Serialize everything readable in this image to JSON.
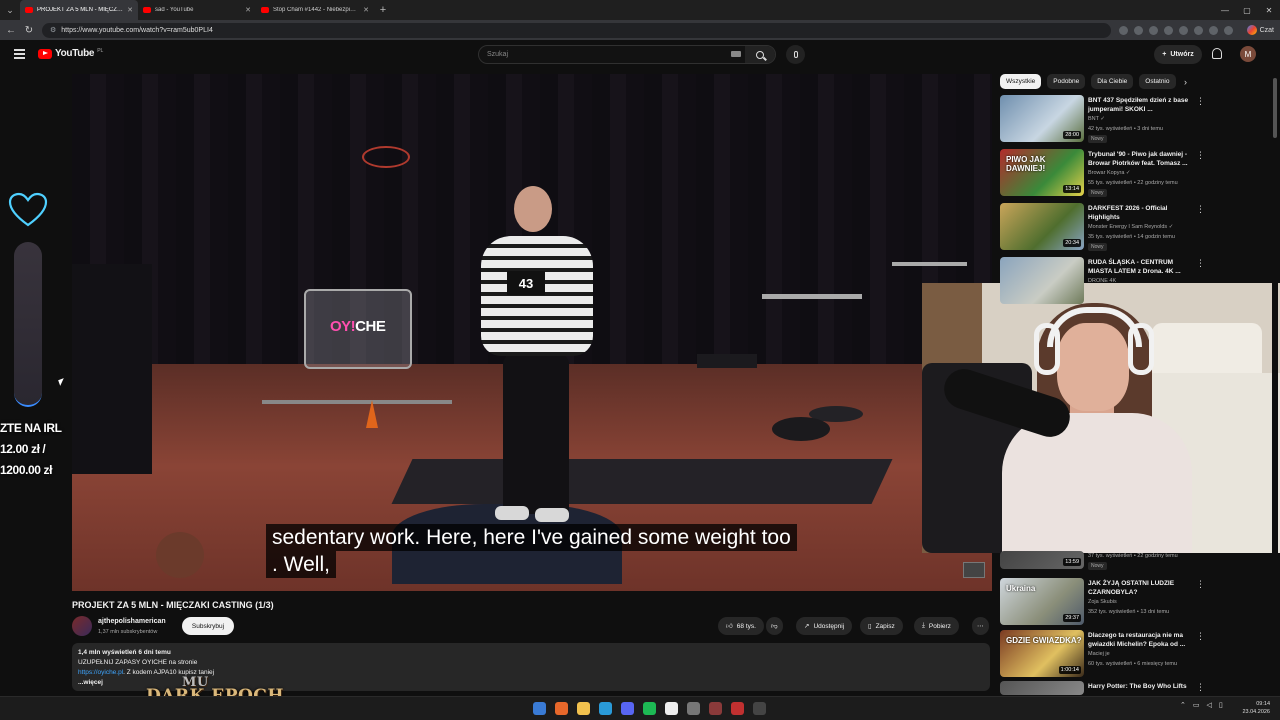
{
  "browser": {
    "tabs": [
      {
        "label": "PROJEKT ZA 5 MLN - MIĘCZAKI",
        "active": true
      },
      {
        "label": "sad - YouTube",
        "active": false
      },
      {
        "label": "Stop Cham #1442 - Niebezpiecz...",
        "active": false
      }
    ],
    "url": "https://www.youtube.com/watch?v=ram5ub0PLI4",
    "chat_label": "Czat"
  },
  "header": {
    "logo": "YouTube",
    "logo_country": "PL",
    "search_placeholder": "Szukaj",
    "create_label": "Utwórz",
    "avatar_letter": "M"
  },
  "overlay": {
    "goal_lines": [
      "ZTE NA IRL",
      "12.00 zł /",
      "1200.00 zł"
    ]
  },
  "video": {
    "subtitle_line1": "sedentary work.  Here, here I've gained some weight too",
    "subtitle_line2": ".  Well,",
    "bib_number": "43",
    "brand_part1": "OY!",
    "brand_part2": "CHE"
  },
  "info": {
    "title": "PROJEKT ZA 5 MLN - MIĘCZAKI CASTING (1/3)",
    "channel": "ajthepolishamerican",
    "subscribers": "1,37 mln subskrybentów",
    "subscribe_label": "Subskrybuj",
    "likes": "68 tys.",
    "share_label": "Udostępnij",
    "save_label": "Zapisz",
    "download_label": "Pobierz",
    "more_label": "⋯",
    "desc_stats": "1,4 mln wyświetleń  6 dni temu",
    "desc_line1": "UZUPEŁNIJ ZAPASY OYICHE na stronie",
    "desc_link": "https://oyiche.pl",
    "desc_line2": ". Z kodem AJPA10 kupisz taniej",
    "desc_more": "...więcej"
  },
  "watermark": {
    "top": "MU",
    "main": "DARK EPOCH"
  },
  "sidebar": {
    "chips": [
      "Wszystkie",
      "Podobne",
      "Dla Ciebie",
      "Ostatnio"
    ],
    "recs": [
      {
        "title": "BNT 437 Spędziłem dzień z base jumperami! SKOKI ...",
        "channel": "BNT",
        "meta": "42 tys. wyświetleń • 3 dni temu",
        "badge": "Nowy",
        "duration": "28:00"
      },
      {
        "title": "Trybunał '90 - Piwo jak dawniej - Browar Piotrków feat. Tomasz ...",
        "channel": "Browar Kopyra",
        "meta": "55 tys. wyświetleń • 22 godziny temu",
        "badge": "Nowy",
        "duration": "13:14"
      },
      {
        "title": "DARKFEST 2026 - Official Highlights",
        "channel": "Monster Energy  I Sam Reynolds",
        "meta": "35 tys. wyświetleń • 14 godzin temu",
        "badge": "Nowy",
        "duration": "20:34"
      },
      {
        "title": "RUDA ŚLĄSKA - CENTRUM MIASTA LATEM z Drona. 4K ...",
        "channel": "DRONE 4K",
        "meta": "",
        "badge": "",
        "duration": ""
      },
      {
        "title": "",
        "channel": "",
        "meta": "37 tys. wyświetleń • 22 godziny temu",
        "badge": "Nowy",
        "duration": "13:59"
      },
      {
        "title": "JAK ŻYJĄ OSTATNI LUDZIE CZARNOBYLA?",
        "channel": "Zoja Skubis",
        "meta": "352 tys. wyświetleń • 13 dni temu",
        "badge": "",
        "duration": "29:37"
      },
      {
        "title": "Dlaczego ta restauracja nie ma gwiazdki Michelin? Epoka od ...",
        "channel": "Maciej je",
        "meta": "60 tys. wyświetleń • 6 miesięcy temu",
        "badge": "",
        "duration": "1:00:14"
      },
      {
        "title": "Harry Potter: The Boy Who Lifts",
        "channel": "",
        "meta": "",
        "badge": "",
        "duration": ""
      }
    ],
    "thumb_text": [
      "",
      "PIWO JAK DAWNIEJ!",
      "",
      "",
      "",
      "Ukraina",
      "GDZIE GWIAZDKA?",
      ""
    ]
  },
  "clock": {
    "time": "09:14",
    "date": "23.04.2026"
  },
  "colors": {
    "accent": "#ff0000",
    "background": "#0f0f0f",
    "link": "#3ea6ff",
    "heart": "#4fd0ff"
  }
}
